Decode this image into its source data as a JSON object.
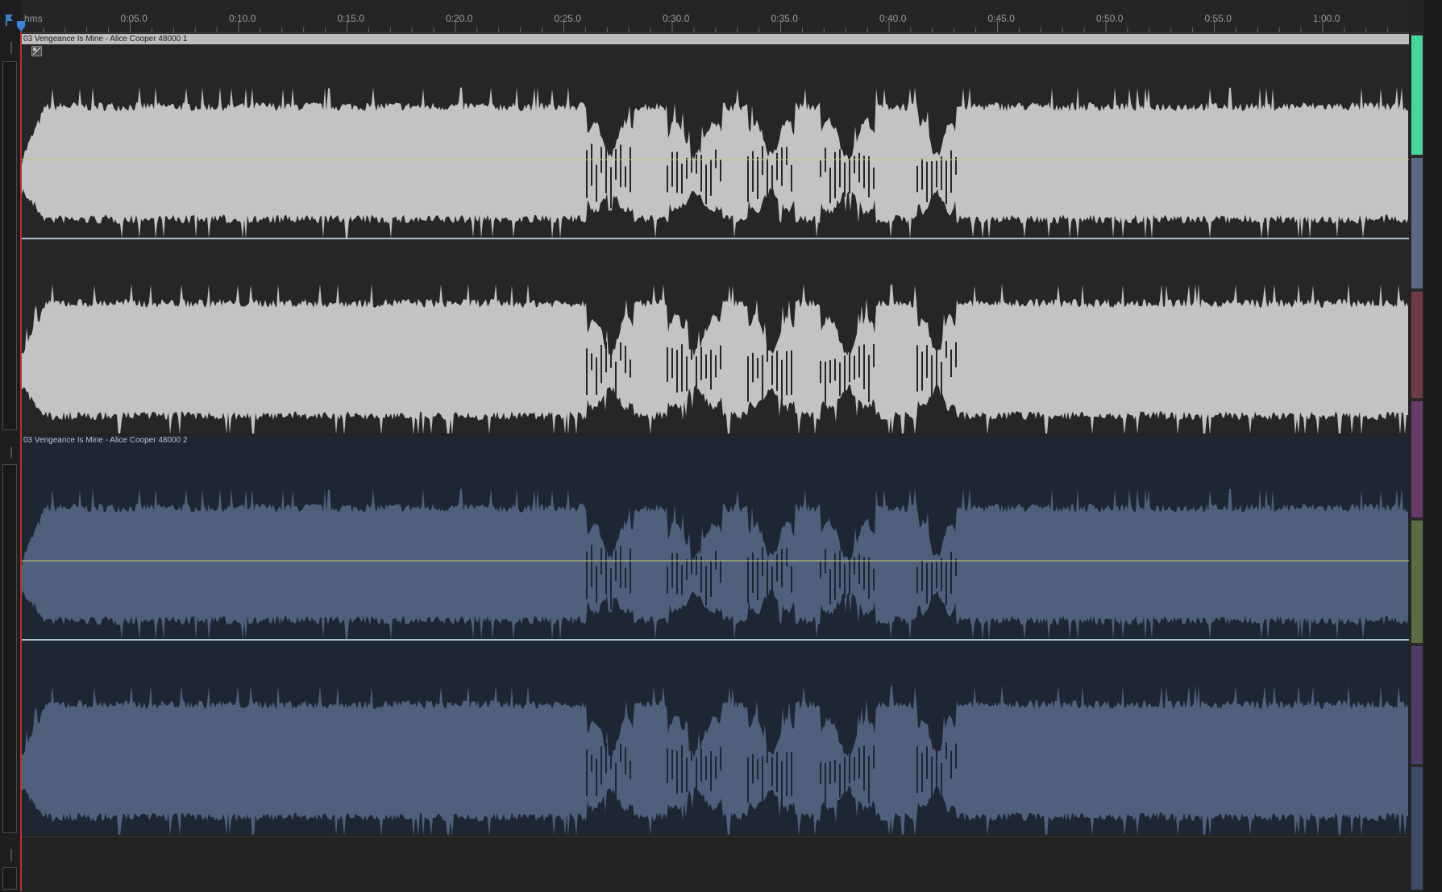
{
  "ruler": {
    "units": "hms",
    "labels": [
      "0:05.0",
      "0:10.0",
      "0:15.0",
      "0:20.0",
      "0:25.0",
      "0:30.0",
      "0:35.0",
      "0:40.0",
      "0:45.0",
      "0:50.0",
      "0:55.0",
      "1:00.0"
    ]
  },
  "clips": [
    {
      "title": "03 Vengeance Is Mine - Alice Cooper 48000 1",
      "selected": true
    },
    {
      "title": "03 Vengeance Is Mine - Alice Cooper 48000 2",
      "selected": false
    }
  ],
  "colors": {
    "playhead": "#b8312f",
    "wave_selected": "#c3c3c3",
    "wave_unselected": "#4f5f7c",
    "center_line": "#c9c978",
    "channel_divider": "#a9c2d6",
    "strip_segments": [
      "#47d69a",
      "#5a6a86",
      "#6e3a45",
      "#6a3b6a",
      "#5b6b42",
      "#4e3c66",
      "#3d4b68"
    ]
  },
  "icons": [
    "marker-icon",
    "track-toggle-icon",
    "fx-icon",
    "playhead-icon"
  ]
}
